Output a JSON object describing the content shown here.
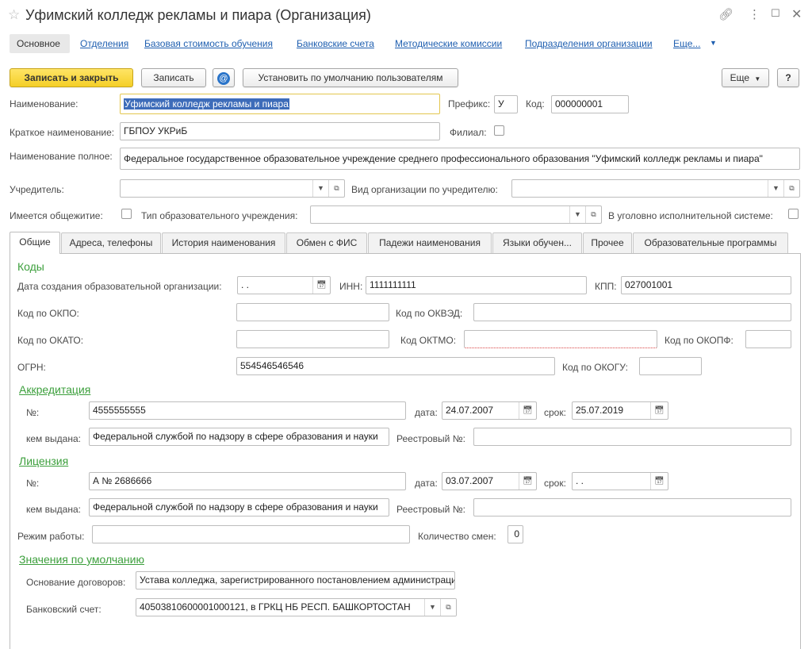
{
  "window": {
    "title": "Уфимский колледж рекламы и пиара (Организация)",
    "link_icon": "link-icon",
    "more_icon": "kebab-menu-icon",
    "maximize_icon": "maximize-icon",
    "close_icon": "close-icon"
  },
  "nav": {
    "items": [
      "Основное",
      "Отделения",
      "Базовая стоимость обучения",
      "Банковские счета",
      "Методические комиссии",
      "Подразделения организации",
      "Еще..."
    ]
  },
  "toolbar": {
    "save_close": "Записать и закрыть",
    "save": "Записать",
    "set_default": "Установить по умолчанию пользователям",
    "more": "Еще",
    "help": "?"
  },
  "header": {
    "name_label": "Наименование:",
    "name_value": "Уфимский колледж рекламы и пиара",
    "prefix_label": "Префикс:",
    "prefix_value": "У",
    "code_label": "Код:",
    "code_value": "000000001",
    "short_label": "Краткое наименование:",
    "short_value": "ГБПОУ УКРиБ",
    "branch_label": "Филиал:",
    "full_label": "Наименование полное:",
    "full_value": "Федеральное государственное образовательное учреждение среднего профессионального образования \"Уфимский колледж рекламы и пиара\"",
    "founder_label": "Учредитель:",
    "founder_value": "",
    "org_kind_label": "Вид организации по учредителю:",
    "org_kind_value": "",
    "dorm_label": "Имеется общежитие:",
    "edu_type_label": "Тип образовательного учреждения:",
    "edu_type_value": "",
    "penal_label": "В уголовно исполнительной системе:"
  },
  "tabs": [
    "Общие",
    "Адреса, телефоны",
    "История наименования",
    "Обмен с ФИС",
    "Падежи наименования",
    "Языки обучен...",
    "Прочее",
    "Образовательные программы"
  ],
  "codes": {
    "section": "Коды",
    "created_label": "Дата создания образовательной организации:",
    "created_value": " .  .",
    "inn_label": "ИНН:",
    "inn_value": "1111111111",
    "kpp_label": "КПП:",
    "kpp_value": "027001001",
    "okpo_label": "Код по ОКПО:",
    "okpo_value": "",
    "okved_label": "Код по ОКВЭД:",
    "okved_value": "",
    "okato_label": "Код по ОКАТО:",
    "okato_value": "",
    "oktmo_label": "Код ОКТМО:",
    "oktmo_value": "",
    "okopf_label": "Код по ОКОПФ:",
    "okopf_value": "",
    "ogrn_label": "ОГРН:",
    "ogrn_value": "554546546546",
    "okogu_label": "Код по ОКОГУ:",
    "okogu_value": ""
  },
  "accreditation": {
    "section": "Аккредитация",
    "num_label": "№:",
    "num_value": "4555555555",
    "date_label": "дата:",
    "date_value": "24.07.2007",
    "term_label": "срок:",
    "term_value": "25.07.2019",
    "issuer_label": "кем выдана:",
    "issuer_value": "Федеральной службой по надзору в сфере образования и науки",
    "reg_label": "Реестровый №:",
    "reg_value": ""
  },
  "license": {
    "section": "Лицензия",
    "num_label": "№:",
    "num_value": "А № 2686666",
    "date_label": "дата:",
    "date_value": "03.07.2007",
    "term_label": "срок:",
    "term_value": " .  .",
    "issuer_label": "кем выдана:",
    "issuer_value": "Федеральной службой по надзору в сфере образования и науки",
    "reg_label": "Реестровый №:",
    "reg_value": ""
  },
  "work": {
    "mode_label": "Режим работы:",
    "mode_value": "",
    "shifts_label": "Количество смен:",
    "shifts_value": "0"
  },
  "defaults": {
    "section": "Значения по умолчанию",
    "basis_label": "Основание договоров:",
    "basis_value": "Устава колледжа, зарегистрированного постановлением администрации",
    "bank_label": "Банковский счет:",
    "bank_value": "40503810600001000121, в ГРКЦ НБ РЕСП. БАШКОРТОСТАН"
  }
}
